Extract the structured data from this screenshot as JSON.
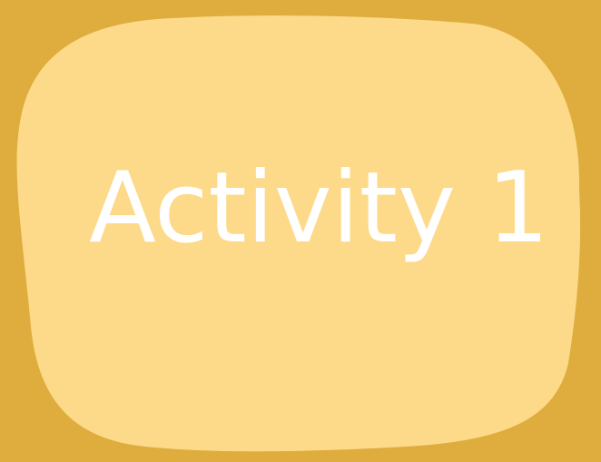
{
  "colors": {
    "background": "#dead3e",
    "blob": "#fdda8a",
    "text": "#ffffff"
  },
  "card": {
    "title": "Activity 1"
  }
}
